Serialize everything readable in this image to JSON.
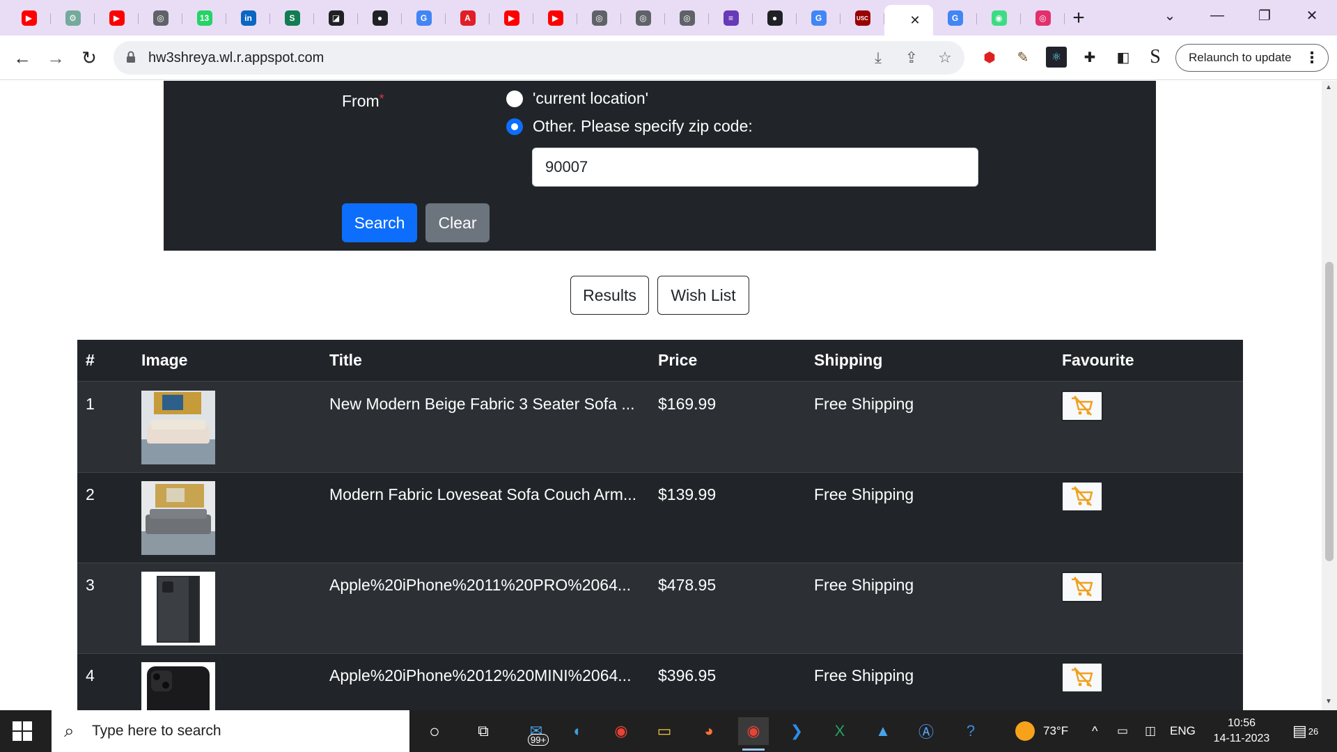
{
  "browser": {
    "url": "hw3shreya.wl.r.appspot.com",
    "relaunch_label": "Relaunch to update",
    "tabs": [
      {
        "icon": "youtube-icon",
        "color": "#ff0000",
        "glyph": "▶"
      },
      {
        "icon": "chatgpt-icon",
        "color": "#74aa9c",
        "glyph": "⚙"
      },
      {
        "icon": "youtube-icon",
        "color": "#ff0000",
        "glyph": "▶"
      },
      {
        "icon": "globe-icon",
        "color": "#5f6368",
        "glyph": "◎"
      },
      {
        "icon": "whatsapp-icon",
        "color": "#25d366",
        "glyph": "13"
      },
      {
        "icon": "linkedin-icon",
        "color": "#0a66c2",
        "glyph": "in"
      },
      {
        "icon": "s-green-icon",
        "color": "#127c52",
        "glyph": "S"
      },
      {
        "icon": "notion-icon",
        "color": "#202124",
        "glyph": "◪"
      },
      {
        "icon": "github-icon",
        "color": "#202124",
        "glyph": "●"
      },
      {
        "icon": "google-icon",
        "color": "#4285f4",
        "glyph": "G"
      },
      {
        "icon": "adobe-icon",
        "color": "#e01e27",
        "glyph": "A"
      },
      {
        "icon": "youtube-icon",
        "color": "#ff0000",
        "glyph": "▶"
      },
      {
        "icon": "youtube-icon",
        "color": "#ff0000",
        "glyph": "▶"
      },
      {
        "icon": "globe-icon",
        "color": "#5f6368",
        "glyph": "◎"
      },
      {
        "icon": "globe-icon",
        "color": "#5f6368",
        "glyph": "◎"
      },
      {
        "icon": "globe-icon",
        "color": "#5f6368",
        "glyph": "◎"
      },
      {
        "icon": "forms-icon",
        "color": "#673ab7",
        "glyph": "≡"
      },
      {
        "icon": "github-icon",
        "color": "#202124",
        "glyph": "●"
      },
      {
        "icon": "google-icon",
        "color": "#4285f4",
        "glyph": "G"
      },
      {
        "icon": "usc-icon",
        "color": "#990000",
        "glyph": "USC"
      }
    ],
    "tabs_after": [
      {
        "icon": "google-icon",
        "color": "#4285f4",
        "glyph": "G"
      },
      {
        "icon": "android-icon",
        "color": "#3ddc84",
        "glyph": "◉"
      },
      {
        "icon": "instagram-icon",
        "color": "#e1306c",
        "glyph": "◎"
      }
    ]
  },
  "form": {
    "from_label": "From",
    "required_mark": "*",
    "option_current": "'current location'",
    "option_other": "Other. Please specify zip code:",
    "zip_value": "90007",
    "search_label": "Search",
    "clear_label": "Clear"
  },
  "views": {
    "results_label": "Results",
    "wishlist_label": "Wish List"
  },
  "table": {
    "headers": {
      "num": "#",
      "image": "Image",
      "title": "Title",
      "price": "Price",
      "shipping": "Shipping",
      "favourite": "Favourite"
    },
    "rows": [
      {
        "num": "1",
        "title": "New Modern Beige Fabric 3 Seater Sofa ...",
        "price": "$169.99",
        "shipping": "Free Shipping",
        "image": "beige-sofa"
      },
      {
        "num": "2",
        "title": "Modern Fabric Loveseat Sofa Couch Arm...",
        "price": "$139.99",
        "shipping": "Free Shipping",
        "image": "grey-sofa"
      },
      {
        "num": "3",
        "title": "Apple%20iPhone%2011%20PRO%2064...",
        "price": "$478.95",
        "shipping": "Free Shipping",
        "image": "iphone-box"
      },
      {
        "num": "4",
        "title": "Apple%20iPhone%2012%20MINI%2064...",
        "price": "$396.95",
        "shipping": "Free Shipping",
        "image": "iphone-black"
      }
    ]
  },
  "taskbar": {
    "search_placeholder": "Type here to search",
    "mail_badge": "99+",
    "weather": "73°F",
    "language": "ENG",
    "time": "10:56",
    "date": "14-11-2023",
    "notifications": "26"
  },
  "colors": {
    "panel": "#212529",
    "primary": "#0d6efd",
    "secondary": "#6c757d",
    "cart": "#f0a020"
  }
}
